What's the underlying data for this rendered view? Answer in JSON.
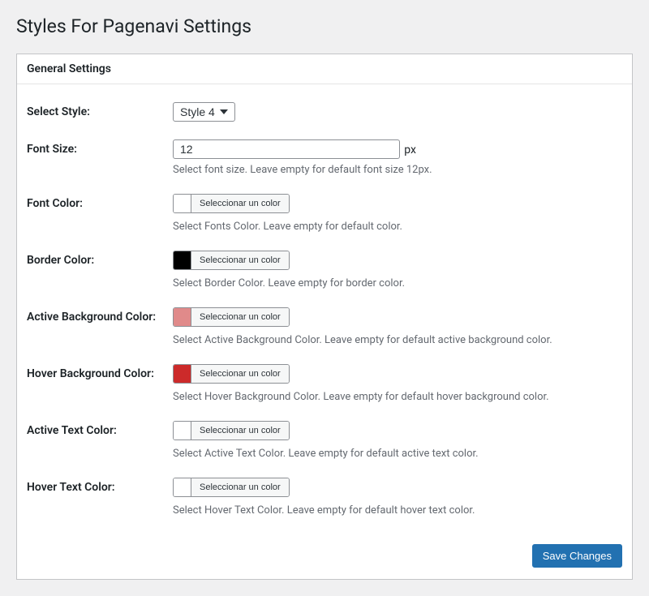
{
  "page_title": "Styles For Pagenavi Settings",
  "panel_title": "General Settings",
  "style": {
    "label": "Select Style:",
    "value": "Style 4"
  },
  "font_size": {
    "label": "Font Size:",
    "value": "12",
    "suffix": "px",
    "desc": "Select font size. Leave empty for default font size 12px."
  },
  "font_color": {
    "label": "Font Color:",
    "btn": "Seleccionar un color",
    "swatch": "",
    "desc": "Select Fonts Color. Leave empty for default color."
  },
  "border_color": {
    "label": "Border Color:",
    "btn": "Seleccionar un color",
    "swatch": "#000000",
    "desc": "Select Border Color. Leave empty for border color."
  },
  "active_bg": {
    "label": "Active Background Color:",
    "btn": "Seleccionar un color",
    "swatch": "#e08a8a",
    "desc": "Select Active Background Color. Leave empty for default active background color."
  },
  "hover_bg": {
    "label": "Hover Background Color:",
    "btn": "Seleccionar un color",
    "swatch": "#cc2a2a",
    "desc": "Select Hover Background Color. Leave empty for default hover background color."
  },
  "active_text": {
    "label": "Active Text Color:",
    "btn": "Seleccionar un color",
    "swatch": "",
    "desc": "Select Active Text Color. Leave empty for default active text color."
  },
  "hover_text": {
    "label": "Hover Text Color:",
    "btn": "Seleccionar un color",
    "swatch": "",
    "desc": "Select Hover Text Color. Leave empty for default hover text color."
  },
  "save_label": "Save Changes"
}
